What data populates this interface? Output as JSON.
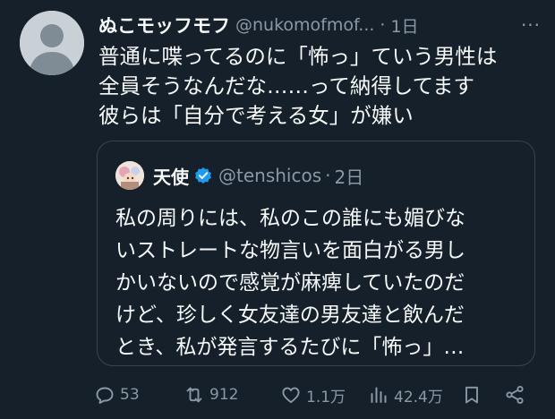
{
  "tweet": {
    "author_name": "ぬこモッフモフ",
    "author_handle": "@nukomofmof...",
    "separator": "·",
    "time": "1日",
    "more_label": "···",
    "lines": [
      "普通に喋ってるのに「怖っ」ていう男性は",
      "全員そうなんだな……って納得してます",
      "彼らは「自分で考える女」が嫌い"
    ]
  },
  "quote": {
    "author_name": "天使",
    "author_handle": "@tenshicos",
    "separator": "·",
    "time": "2日",
    "lines": [
      "私の周りには、私のこの誰にも媚びな",
      "いストレートな物言いを面白がる男し",
      "かいないので感覚が麻痺していたのだ",
      "けど、珍しく女友達の男友達と飲んだ",
      "とき、私が発言するたびに「怖っ」…"
    ]
  },
  "actions": {
    "replies": "53",
    "reposts": "912",
    "likes": "1.1万",
    "views": "42.4万"
  },
  "icons": {
    "reply": "reply-icon",
    "repost": "repost-icon",
    "like": "heart-icon",
    "views": "views-icon",
    "bookmark": "bookmark-icon",
    "share": "share-icon",
    "verified": "verified-badge-icon"
  },
  "colors": {
    "background": "#15202b",
    "text": "#f7f9f9",
    "muted": "#8b98a5",
    "border": "#38444d",
    "verified": "#1d9bf0"
  }
}
